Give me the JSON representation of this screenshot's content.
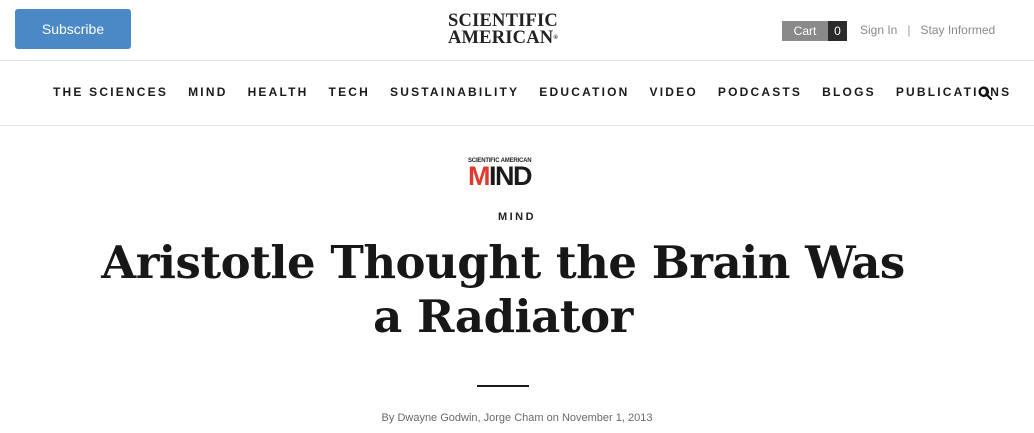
{
  "header": {
    "subscribe_label": "Subscribe",
    "logo_line1": "SCIENTIFIC",
    "logo_line2": "AMERICAN",
    "logo_mark": "®",
    "cart_label": "Cart",
    "cart_count": "0",
    "sign_in": "Sign In",
    "separator": "|",
    "stay_informed": "Stay Informed"
  },
  "nav": {
    "items": [
      {
        "label": "THE SCIENCES"
      },
      {
        "label": "MIND"
      },
      {
        "label": "HEALTH"
      },
      {
        "label": "TECH"
      },
      {
        "label": "SUSTAINABILITY"
      },
      {
        "label": "EDUCATION"
      },
      {
        "label": "VIDEO"
      },
      {
        "label": "PODCASTS"
      },
      {
        "label": "BLOGS"
      },
      {
        "label": "PUBLICATIONS"
      }
    ],
    "search_icon": "search-icon"
  },
  "article": {
    "section_logo_sub": "SCIENTIFIC AMERICAN",
    "section_logo_m": "M",
    "section_logo_rest": "IND",
    "section_label": "MIND",
    "headline": "Aristotle Thought the Brain Was a Radiator",
    "byline_prefix": "By",
    "author1": "Dwayne Godwin",
    "author_sep": ",",
    "author2": "Jorge Cham",
    "date_prefix": "on",
    "date": "November 1, 2013"
  },
  "colors": {
    "subscribe_bg": "#4a88c6",
    "mind_red": "#e03a2f",
    "cart_gray": "#8a8a8a",
    "cart_dark": "#2b2b2b"
  }
}
